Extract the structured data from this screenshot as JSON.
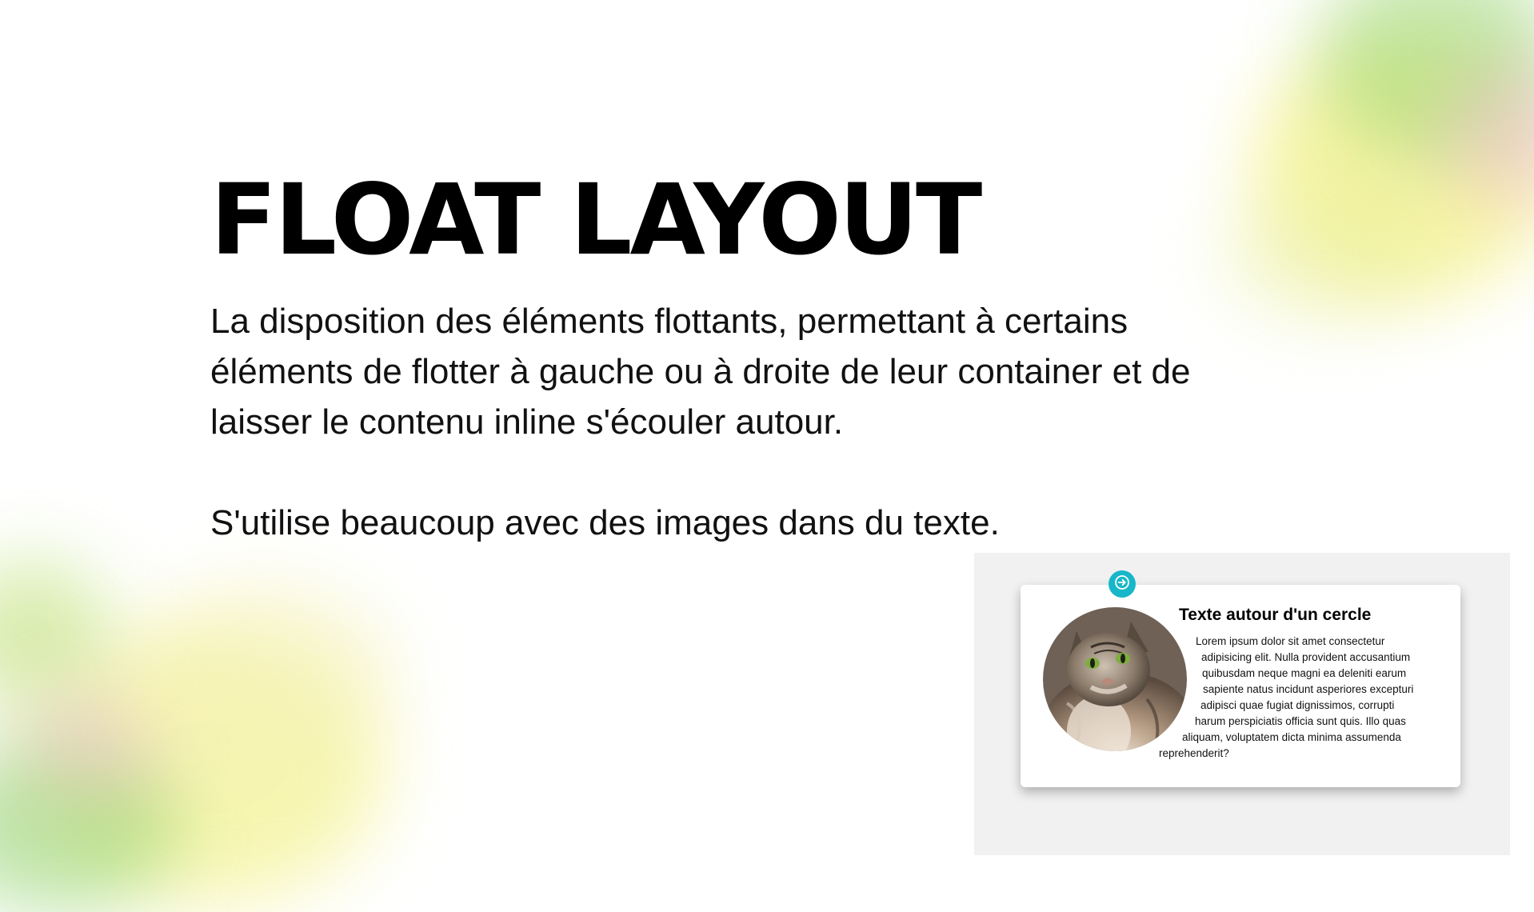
{
  "slide": {
    "title": "FLOAT LAYOUT",
    "description": "La disposition des éléments flottants, permettant à certains éléments de flotter à gauche ou à droite de leur container et de laisser le contenu inline s'écouler autour.",
    "note": "S'utilise beaucoup avec des images dans du texte."
  },
  "demo": {
    "icon": "arrow-right-icon",
    "accent_color": "#17b7c9",
    "panel_color": "#f1f1f1",
    "image": "cat-photo",
    "card_title": "Texte autour d'un cercle",
    "lines": [
      "Lorem ipsum dolor sit amet consectetur",
      "adipisicing elit. Nulla provident accusantium",
      "quibusdam neque magni ea deleniti earum",
      "sapiente natus incidunt asperiores excepturi",
      "adipisci quae fugiat dignissimos, corrupti",
      "harum perspiciatis officia sunt quis. Illo quas",
      "aliquam, voluptatem dicta minima assumenda",
      "reprehenderit?"
    ]
  }
}
